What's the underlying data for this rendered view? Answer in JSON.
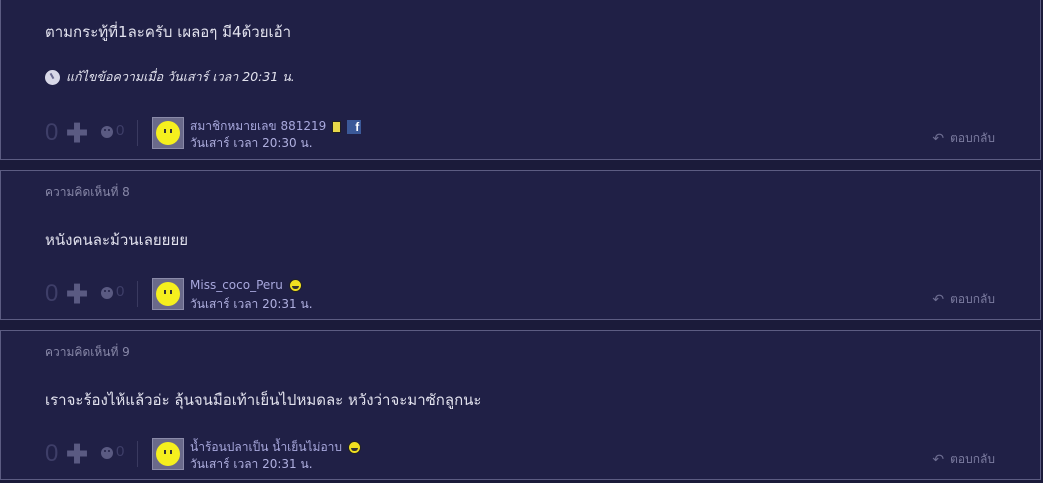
{
  "comments": [
    {
      "text": "ตามกระทู้ที่1ละครับ เผลอๆ มี4ด้วยเอ้า",
      "edit_note": "แก้ไขข้อความเมื่อ วันเสาร์ เวลา 20:31 น.",
      "votes": "0",
      "emotions": "0",
      "author": "สมาชิกหมายเลข 881219",
      "timestamp": "วันเสาร์ เวลา 20:30 น.",
      "reply_label": "ตอบกลับ"
    },
    {
      "number_label": "ความคิดเห็นที่ 8",
      "text": "หนังคนละม้วนเลยยยย",
      "votes": "0",
      "emotions": "0",
      "author": "Miss_coco_Peru",
      "timestamp": "วันเสาร์ เวลา 20:31 น.",
      "reply_label": "ตอบกลับ"
    },
    {
      "number_label": "ความคิดเห็นที่ 9",
      "text": "เราจะร้องไห้แล้วอ่ะ ลุ้นจนมือเท้าเย็นไปหมดละ หวังว่าจะมาซักลูกนะ",
      "votes": "0",
      "emotions": "0",
      "author": "น้ำร้อนปลาเป็น น้ำเย็นไม่อาบ",
      "timestamp": "วันเสาร์ เวลา 20:31 น.",
      "reply_label": "ตอบกลับ"
    }
  ],
  "icons": {
    "reply": "reply-arrow-icon",
    "vote_plus": "plus-icon",
    "emotion": "emotion-face-icon",
    "facebook": "facebook-icon",
    "mobile": "mobile-phone-icon",
    "smile": "smile-icon",
    "edit": "edit-icon"
  }
}
